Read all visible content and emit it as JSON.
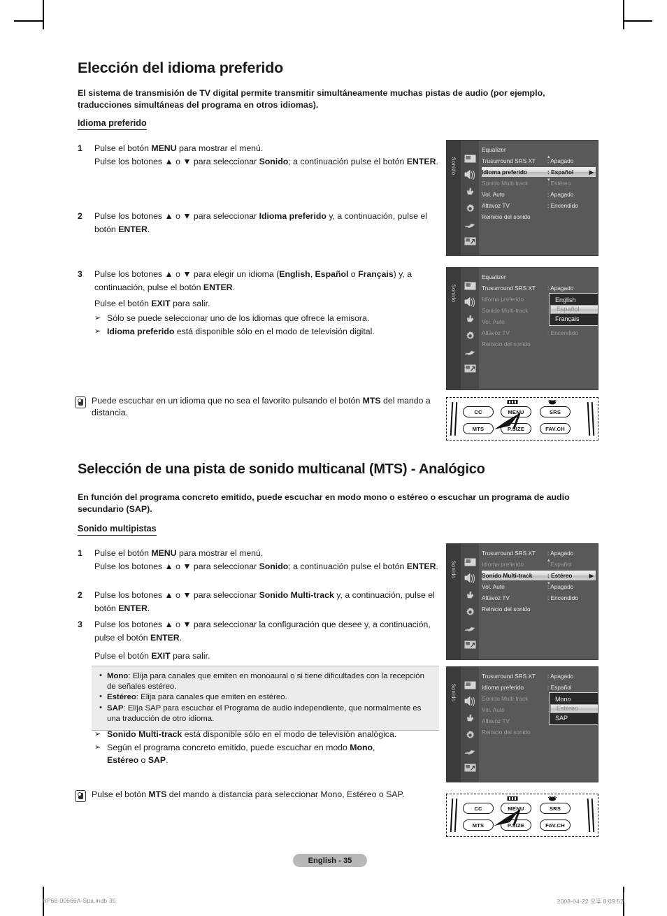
{
  "page": {
    "badge": "English - 35",
    "imprint_left": "BP68-00666A-Spa.indb   35",
    "imprint_right": "2008-04-22   오후 8:09:52"
  },
  "section1": {
    "title": "Elección del idioma preferido",
    "intro": "El sistema de transmisión de TV digital permite transmitir simultáneamente muchas pistas de audio (por ejemplo, traducciones simultáneas del programa en otros idiomas).",
    "subhead": "Idioma preferido",
    "steps": [
      {
        "num": "1",
        "line1_a": "Pulse el botón ",
        "line1_b": "MENU",
        "line1_c": " para mostrar el menú.",
        "line2_a": "Pulse los botones ▲ o ▼ para seleccionar ",
        "line2_b": "Sonido",
        "line2_c": "; a continuación pulse el botón ",
        "line2_d": "ENTER",
        "line2_e": "."
      },
      {
        "num": "2",
        "line1_a": "Pulse los botones ▲ o ▼ para seleccionar ",
        "line1_b": "Idioma preferido",
        "line1_c": " y, a continuación, pulse el botón ",
        "line1_d": "ENTER",
        "line1_e": "."
      },
      {
        "num": "3",
        "line1_a": "Pulse los botones ▲ o ▼ para elegir un idioma (",
        "line1_b": "English",
        "line1_c": ", ",
        "line1_d": "Español",
        "line1_e": " o ",
        "line1_f": "Français",
        "line1_g": ") y, a continuación, pulse el botón ",
        "line1_h": "ENTER",
        "line1_i": "."
      }
    ],
    "exit_a": "Pulse el botón ",
    "exit_b": "EXIT",
    "exit_c": " para salir.",
    "bullets": [
      {
        "arrow": "➢",
        "text": "Sólo se puede seleccionar uno de los idiomas que ofrece la emisora."
      },
      {
        "arrow": "➢",
        "bold": "Idioma preferido",
        "text": " está disponible sólo en el modo de televisión digital."
      }
    ],
    "note_a": "Puede escuchar en un idioma que no sea el favorito pulsando el botón ",
    "note_b": "MTS",
    "note_c": " del mando a distancia."
  },
  "section2": {
    "title": "Selección de una pista de sonido multicanal (MTS) - Analógico",
    "intro": "En función del programa concreto emitido, puede escuchar en modo mono o estéreo o escuchar un programa de audio secundario (SAP).",
    "subhead": "Sonido multipistas",
    "steps": [
      {
        "num": "1",
        "line1_a": "Pulse el botón ",
        "line1_b": "MENU",
        "line1_c": " para mostrar el menú.",
        "line2_a": "Pulse los botones ▲ o ▼ para seleccionar ",
        "line2_b": "Sonido",
        "line2_c": "; a continuación pulse el botón ",
        "line2_d": "ENTER",
        "line2_e": "."
      },
      {
        "num": "2",
        "line1_a": "Pulse los botones ▲ o ▼ para seleccionar ",
        "line1_b": "Sonido Multi-track",
        "line1_c": " y, a continuación, pulse el botón ",
        "line1_d": "ENTER",
        "line1_e": "."
      },
      {
        "num": "3",
        "line1_a": "Pulse los botones ▲ o ▼ para seleccionar la configuración que desee y, a continuación, pulse el botón ",
        "line1_b": "ENTER",
        "line1_c": "."
      }
    ],
    "exit_a": "Pulse el botón ",
    "exit_b": "EXIT",
    "exit_c": " para salir.",
    "infobox": [
      {
        "dot": "•",
        "bold": "Mono",
        "text": ": Elija para canales que emiten en monoaural o si tiene dificultades con la recepción de señales estéreo."
      },
      {
        "dot": "•",
        "bold": "Estéreo",
        "text": ": Elija para canales que emiten en estéreo."
      },
      {
        "dot": "•",
        "bold": "SAP",
        "text": ": Elija SAP para escuchar el Programa de audio independiente, que normalmente es una traducción de otro idioma."
      }
    ],
    "bullets": [
      {
        "arrow": "➢",
        "bold": "Sonido Multi-track",
        "text": " está disponible sólo en el modo de televisión analógica."
      },
      {
        "arrow": "➢",
        "text_a": "Según el programa concreto emitido, puede escuchar en modo ",
        "bold_a": "Mono",
        "text_b": ", ",
        "bold_b": "Estéreo",
        "text_c": " o ",
        "bold_c": "SAP",
        "text_d": "."
      }
    ],
    "note_a": "Pulse el botón ",
    "note_b": "MTS",
    "note_c": " del mando a distancia para seleccionar Mono, Estéreo o SAP."
  },
  "tvmenu": {
    "sidebar_label": "Sonido",
    "icons": [
      "picture-icon",
      "sound-icon",
      "channel-icon",
      "setup-icon",
      "input-icon",
      "support-icon"
    ],
    "shot1": {
      "rows": [
        {
          "label": "Equalizer",
          "value": "",
          "state": "normal"
        },
        {
          "label": "Trusurround SRS XT",
          "value": ": Apagado",
          "state": "normal"
        },
        {
          "label": "Idioma preferido",
          "value": ": Español",
          "state": "selected",
          "arrow": "▶"
        },
        {
          "label": "Sonido Multi-track",
          "value": ": Estéreo",
          "state": "dim"
        },
        {
          "label": "Vol. Auto",
          "value": ": Apagado",
          "state": "normal"
        },
        {
          "label": "Altavoz TV",
          "value": ": Encendido",
          "state": "normal"
        },
        {
          "label": "Reinicio del sonido",
          "value": "",
          "state": "normal"
        }
      ]
    },
    "shot2": {
      "rows": [
        {
          "label": "Equalizer",
          "value": "",
          "state": "normal"
        },
        {
          "label": "Trusurround SRS XT",
          "value": ": Apagado",
          "state": "normal"
        },
        {
          "label": "Idioma preferido",
          "value": ":",
          "state": "dim"
        },
        {
          "label": "Sonido Multi-track",
          "value": ":",
          "state": "dim"
        },
        {
          "label": "Vol. Auto",
          "value": ":",
          "state": "dim"
        },
        {
          "label": "Altavoz TV",
          "value": ": Encendido",
          "state": "dim"
        },
        {
          "label": "Reinicio del sonido",
          "value": "",
          "state": "dim"
        }
      ],
      "popup": [
        {
          "label": "English",
          "on": false
        },
        {
          "label": "Español",
          "on": true
        },
        {
          "label": "Français",
          "on": false
        }
      ]
    },
    "shot3": {
      "rows": [
        {
          "label": "Trusurround SRS XT",
          "value": ": Apagado",
          "state": "normal"
        },
        {
          "label": "Idioma preferido",
          "value": ": Español",
          "state": "dim"
        },
        {
          "label": "Sonido Multi-track",
          "value": ": Estéreo",
          "state": "selected",
          "arrow": "▶"
        },
        {
          "label": "Vol. Auto",
          "value": ": Apagado",
          "state": "normal"
        },
        {
          "label": "Altavoz TV",
          "value": ": Encendido",
          "state": "normal"
        },
        {
          "label": "Reinicio del sonido",
          "value": "",
          "state": "normal"
        }
      ]
    },
    "shot4": {
      "rows": [
        {
          "label": "Trusurround SRS XT",
          "value": ": Apagado",
          "state": "normal"
        },
        {
          "label": "Idioma preferido",
          "value": ": Español",
          "state": "normal"
        },
        {
          "label": "Sonido Multi-track",
          "value": ":",
          "state": "dim"
        },
        {
          "label": "Vol. Auto",
          "value": ":",
          "state": "dim"
        },
        {
          "label": "Altavoz TV",
          "value": ":",
          "state": "dim"
        },
        {
          "label": "Reinicio del sonido",
          "value": "",
          "state": "dim"
        }
      ],
      "popup": [
        {
          "label": "Mono",
          "on": false
        },
        {
          "label": "Estéreo",
          "on": true
        },
        {
          "label": "SAP",
          "on": false
        }
      ]
    }
  },
  "remote": {
    "buttons_top": [
      "CC",
      "MENU",
      "SRS"
    ],
    "buttons_bottom": [
      "MTS",
      "P.SIZE",
      "FAV.CH"
    ],
    "highlighted": "MTS"
  }
}
